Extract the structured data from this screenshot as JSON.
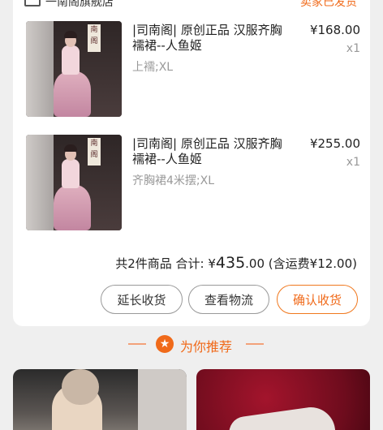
{
  "order": {
    "shop_name": "一南阁旗舰店",
    "status": "卖家已发货",
    "items": [
      {
        "title": "|司南阁| 原创正品 汉服齐胸襦裙--人鱼姬",
        "spec": "上襦;XL",
        "price": "¥168.00",
        "qty": "x1",
        "sign_text": "南阁"
      },
      {
        "title": "|司南阁| 原创正品 汉服齐胸襦裙--人鱼姬",
        "spec": "齐胸裙4米摆;XL",
        "price": "¥255.00",
        "qty": "x1",
        "sign_text": "南阁"
      }
    ],
    "summary": {
      "count_text": "共2件商品",
      "total_label": "合计: ",
      "currency": "¥",
      "total_int": "435",
      "total_dec": ".00",
      "shipping_text": "(含运费¥12.00)"
    },
    "buttons": {
      "extend": "延长收货",
      "logistics": "查看物流",
      "confirm": "确认收货"
    }
  },
  "recommend": {
    "label": "为你推荐",
    "badge_icon": "star-icon",
    "badge_glyph": "★"
  },
  "colors": {
    "accent": "#f06a1a",
    "background": "#efefef"
  }
}
